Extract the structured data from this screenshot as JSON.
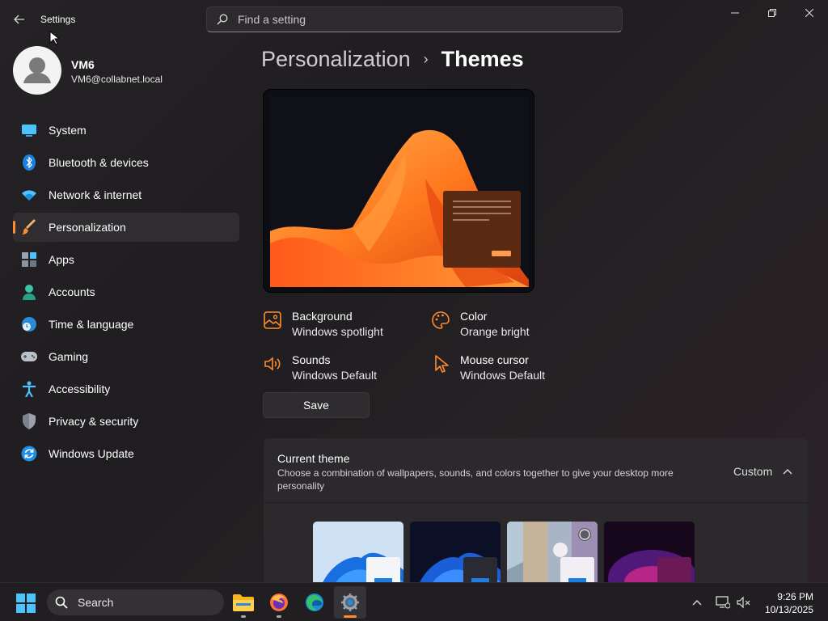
{
  "window": {
    "app_title": "Settings",
    "search_placeholder": "Find a setting"
  },
  "profile": {
    "name": "VM6",
    "email": "VM6@collabnet.local"
  },
  "nav": {
    "items": [
      {
        "label": "System",
        "icon": "system-icon"
      },
      {
        "label": "Bluetooth & devices",
        "icon": "bluetooth-icon"
      },
      {
        "label": "Network & internet",
        "icon": "wifi-icon"
      },
      {
        "label": "Personalization",
        "icon": "brush-icon",
        "active": true
      },
      {
        "label": "Apps",
        "icon": "apps-icon"
      },
      {
        "label": "Accounts",
        "icon": "accounts-icon"
      },
      {
        "label": "Time & language",
        "icon": "globe-clock-icon"
      },
      {
        "label": "Gaming",
        "icon": "gamepad-icon"
      },
      {
        "label": "Accessibility",
        "icon": "accessibility-icon"
      },
      {
        "label": "Privacy & security",
        "icon": "shield-icon"
      },
      {
        "label": "Windows Update",
        "icon": "update-icon"
      }
    ]
  },
  "breadcrumb": {
    "parent": "Personalization",
    "separator": "›",
    "current": "Themes"
  },
  "theme_props": {
    "background": {
      "label": "Background",
      "value": "Windows spotlight"
    },
    "color": {
      "label": "Color",
      "value": "Orange bright"
    },
    "sounds": {
      "label": "Sounds",
      "value": "Windows Default"
    },
    "cursor": {
      "label": "Mouse cursor",
      "value": "Windows Default"
    }
  },
  "save_label": "Save",
  "current_theme": {
    "title": "Current theme",
    "description": "Choose a combination of wallpapers, sounds, and colors together to give your desktop more personality",
    "value": "Custom"
  },
  "taskbar": {
    "search_label": "Search",
    "time": "9:26 PM",
    "date": "10/13/2025"
  },
  "colors": {
    "accent": "#ff8c2e",
    "window_bg": "#242224",
    "card_bg": "#2b292c"
  }
}
